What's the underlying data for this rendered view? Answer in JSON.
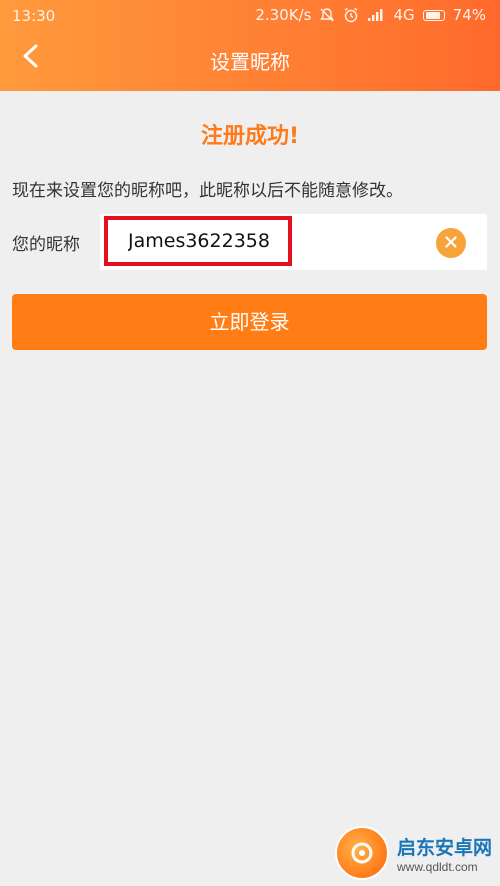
{
  "status_bar": {
    "time": "13:30",
    "network_speed": "2.30K/s",
    "network_type": "4G",
    "battery": "74%"
  },
  "header": {
    "title": "设置昵称"
  },
  "content": {
    "success_title": "注册成功!",
    "instruction": "现在来设置您的昵称吧，此昵称以后不能随意修改。",
    "nickname_label": "您的昵称",
    "nickname_value": "James3622358",
    "login_button": "立即登录"
  },
  "watermark": {
    "name": "启东安卓网",
    "url": "www.qdldt.com"
  },
  "colors": {
    "accent": "#ff7d14",
    "success_text": "#ff7a1a",
    "highlight_box": "#e3101f",
    "clear_icon": "#f6a43a"
  },
  "icons": {
    "back": "chevron-left-icon",
    "clear": "clear-x-icon",
    "mute": "bell-off-icon",
    "alarm": "alarm-icon",
    "signal": "signal-icon",
    "battery": "battery-icon"
  }
}
